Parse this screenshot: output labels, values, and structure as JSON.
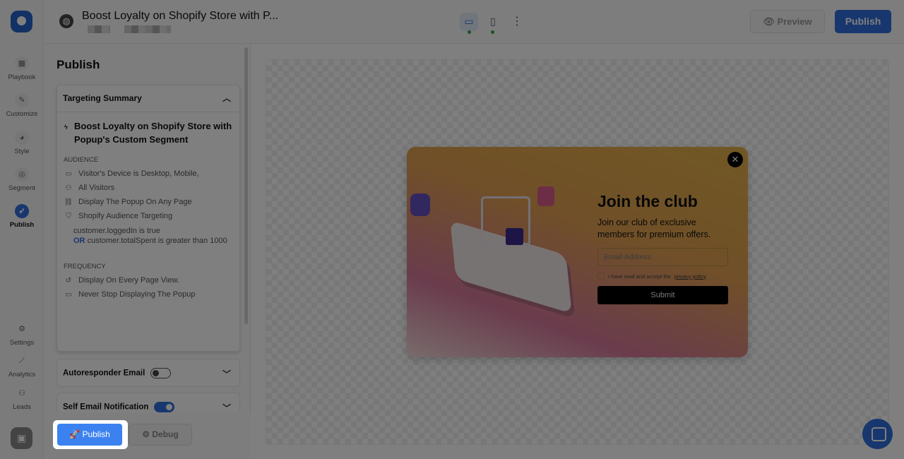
{
  "header": {
    "title": "Boost Loyalty on Shopify Store with P...",
    "preview_label": "Preview",
    "publish_label": "Publish"
  },
  "rail": {
    "items": [
      {
        "label": "Playbook",
        "icon": "grid-icon"
      },
      {
        "label": "Customize",
        "icon": "pencil-icon"
      },
      {
        "label": "Style",
        "icon": "palette-icon"
      },
      {
        "label": "Segment",
        "icon": "target-icon"
      },
      {
        "label": "Publish",
        "icon": "rocket-icon",
        "active": true
      }
    ],
    "bottom": [
      {
        "label": "Settings",
        "icon": "gear-icon"
      },
      {
        "label": "Analytics",
        "icon": "chart-line-icon"
      },
      {
        "label": "Leads",
        "icon": "users-icon"
      }
    ]
  },
  "panel": {
    "title": "Publish",
    "summary": {
      "header": "Targeting Summary",
      "segment": "Boost Loyalty on Shopify Store with Popup's Custom Segment",
      "audience_label": "AUDIENCE",
      "audience": [
        "Visitor's Device is Desktop, Mobile,",
        "All Visitors",
        "Display The Popup On Any Page",
        "Shopify Audience Targeting"
      ],
      "condition1": "customer.loggedIn is true",
      "or": "OR",
      "condition2": "customer.totalSpent is greater than 1000",
      "frequency_label": "FREQUENCY",
      "frequency": [
        "Display On Every Page View.",
        "Never Stop Displaying The Popup"
      ]
    },
    "autoresponder": {
      "label": "Autoresponder Email",
      "enabled": false
    },
    "self_notification": {
      "label": "Self Email Notification",
      "enabled": true
    },
    "publish_button": "Publish",
    "debug_button": "Debug"
  },
  "popup": {
    "title": "Join the club",
    "description": "Join our club of exclusive members for premium offers.",
    "email_placeholder": "Email Address",
    "consent_text": "I have read and accept the",
    "consent_link": "privacy policy",
    "submit": "Submit"
  },
  "colors": {
    "accent": "#2f6fdc",
    "highlight_button": "#3b82f0"
  }
}
